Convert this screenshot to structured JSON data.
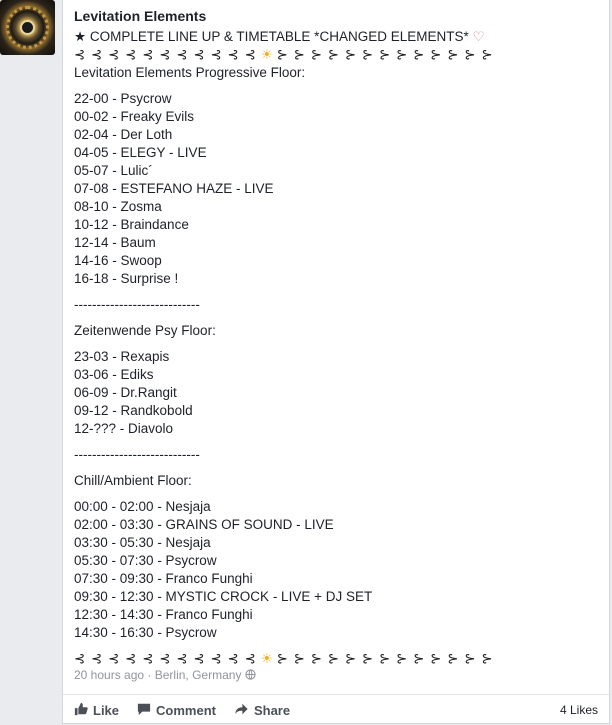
{
  "post": {
    "page_name": "Levitation Elements",
    "headline_star": "★",
    "headline_text": "COMPLETE LINE UP & TIMETABLE *CHANGED ELEMENTS*",
    "headline_heart": "♡",
    "arrows_left": "⊰ ⊰ ⊰ ⊰ ⊰ ⊰ ⊰ ⊰ ⊰ ⊰ ⊰",
    "sun": "☀",
    "arrows_right": "⊱ ⊱ ⊱ ⊱ ⊱ ⊱ ⊱ ⊱ ⊱ ⊱ ⊱ ⊱ ⊱",
    "section1_title": "Levitation Elements Progressive Floor:",
    "section1_items": [
      "22-00 - Psycrow",
      "00-02 - Freaky Evils",
      "02-04 - Der Loth",
      "04-05 - ELEGY - LIVE",
      "05-07 - Lulic´",
      "07-08 - ESTEFANO HAZE - LIVE",
      "08-10 - Zosma",
      "10-12 - Braindance",
      "12-14 - Baum",
      "14-16 - Swoop",
      "16-18 - Surprise !"
    ],
    "separator": "----------------------------",
    "section2_title": "Zeitenwende Psy Floor:",
    "section2_items": [
      "23-03 - Rexapis",
      "03-06 - Ediks",
      "06-09 - Dr.Rangit",
      "09-12 - Randkobold",
      "12-??? - Diavolo"
    ],
    "section3_title": "Chill/Ambient Floor:",
    "section3_items": [
      "00:00 - 02:00 - Nesjaja",
      "02:00 - 03:30 - GRAINS OF SOUND - LIVE",
      "03:30 - 05:30 - Nesjaja",
      "05:30 - 07:30 - Psycrow",
      "07:30 - 09:30 - Franco Funghi",
      "09:30 - 12:30 - MYSTIC CROCK - LIVE + DJ SET",
      "12:30 - 14:30 - Franco Funghi",
      "14:30 - 16:30 - Psycrow"
    ],
    "time_ago": "20 hours ago",
    "meta_sep": "·",
    "location": "Berlin, Germany"
  },
  "actions": {
    "like_label": "Like",
    "comment_label": "Comment",
    "share_label": "Share",
    "likes_count": "4 Likes"
  },
  "icons": {
    "like": "thumbs-up-icon",
    "comment": "speech-bubble-icon",
    "share": "share-arrow-icon",
    "globe": "globe-icon"
  },
  "colors": {
    "accent_text": "#4b4f56",
    "meta_text": "#90949c",
    "heart": "#e7738f",
    "sun": "#f0b020"
  }
}
